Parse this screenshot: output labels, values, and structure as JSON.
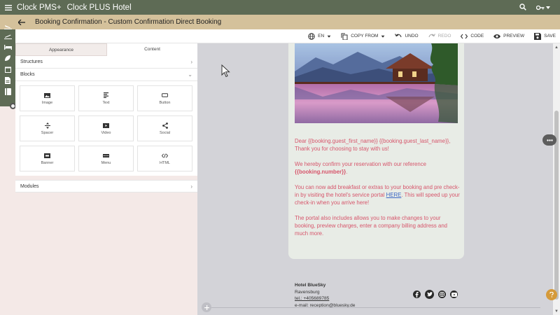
{
  "topbar": {
    "title": "Clock PMS+",
    "hotel": "Clock PLUS Hotel"
  },
  "header": {
    "title": "Booking Confirmation - Custom Confirmation Direct Booking"
  },
  "toolbar": {
    "language": "EN",
    "copy_from": "COPY FROM",
    "undo": "UNDO",
    "redo": "REDO",
    "code": "CODE",
    "preview": "PREVIEW",
    "save": "SAVE"
  },
  "panel": {
    "tabs": [
      "Appearance",
      "Content"
    ],
    "structures": "Structures",
    "blocks": "Blocks",
    "modules": "Modules",
    "block_items": [
      "Image",
      "Text",
      "Button",
      "Spacer",
      "Video",
      "Social",
      "Banner",
      "Menu",
      "HTML"
    ]
  },
  "email": {
    "p1_line1": "Dear {{booking.guest_first_name}} {{booking.guest_last_name}},",
    "p1_line2": "Thank you for choosing to stay with us!",
    "p2_text": "We hereby confirm your reservation with our reference ",
    "p2_ref": "{{booking.number}}",
    "p2_end": ".",
    "p3_text": "You can now add breakfast or extras to your booking and pre check-in by visiting the hotel's service portal ",
    "p3_link": "HERE",
    "p3_end": ". This will speed up your check-in when you arrive here!",
    "p4_text": "The portal also includes allows you to make changes to your booking, preview charges, enter a company billing address and much more."
  },
  "footer": {
    "hotel_name": "Hotel BlueSky",
    "city": "Ravensburg",
    "tel": "tel.: +405689785",
    "email": "e-mail: reception@bluesky.de"
  },
  "colors": {
    "topbar": "#5e6b55",
    "header": "#d4c19b",
    "email_text": "#d6556b",
    "link": "#3a66c4"
  }
}
